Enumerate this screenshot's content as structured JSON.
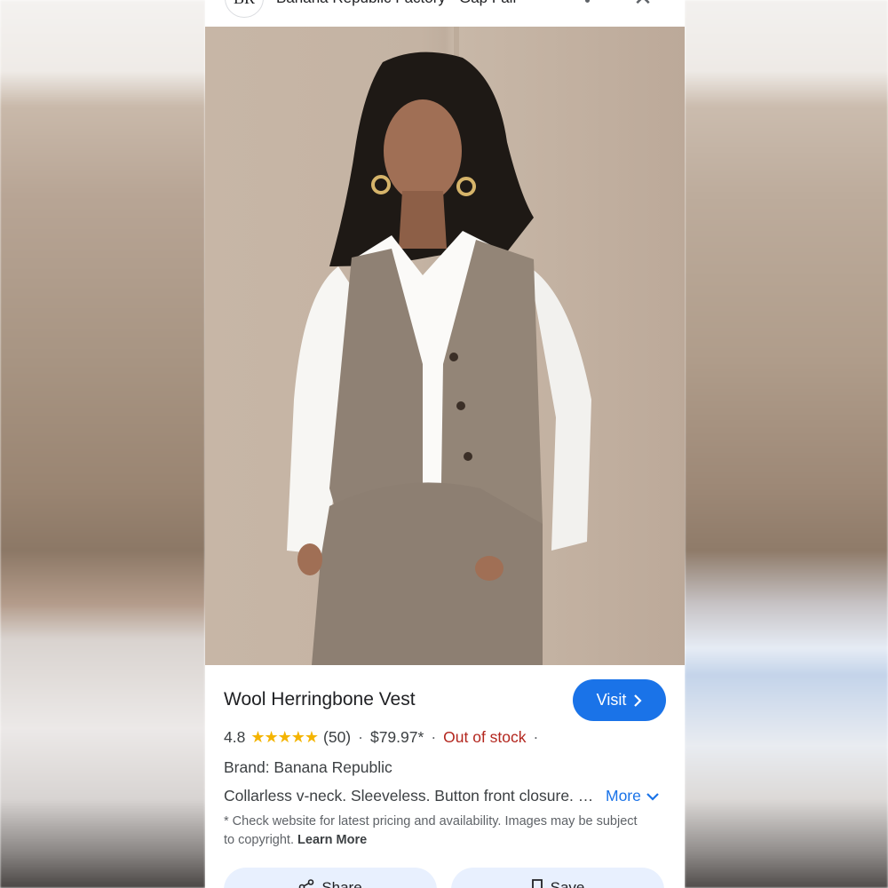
{
  "header": {
    "logo_text": "BR",
    "source_title": "Banana Republic Factory · Gap Fall",
    "close_glyph": "✕"
  },
  "product": {
    "title": "Wool Herringbone Vest",
    "visit_label": "Visit",
    "rating": "4.8",
    "stars": "★★★★★",
    "review_count": "(50)",
    "price": "$79.97*",
    "stock_status": "Out of stock",
    "brand": "Brand: Banana Republic",
    "description": "Collarless v-neck. Sleeveless. Button front closure. Welt pockets.",
    "more_label": "More",
    "disclaimer": "* Check website for latest pricing and availability. Images may be subject to copyright.",
    "learn_more_label": "Learn More"
  },
  "actions": {
    "share_label": "Share",
    "save_label": "Save"
  },
  "colors": {
    "accent": "#1a73e8",
    "stock_red": "#b3261e",
    "star_yellow": "#f4b400",
    "action_bg": "#e8f0fe"
  },
  "icons": [
    "close-icon",
    "more-vert-icon",
    "chevron-right-icon",
    "star-icon",
    "chevron-down-icon",
    "share-icon",
    "bookmark-icon"
  ]
}
